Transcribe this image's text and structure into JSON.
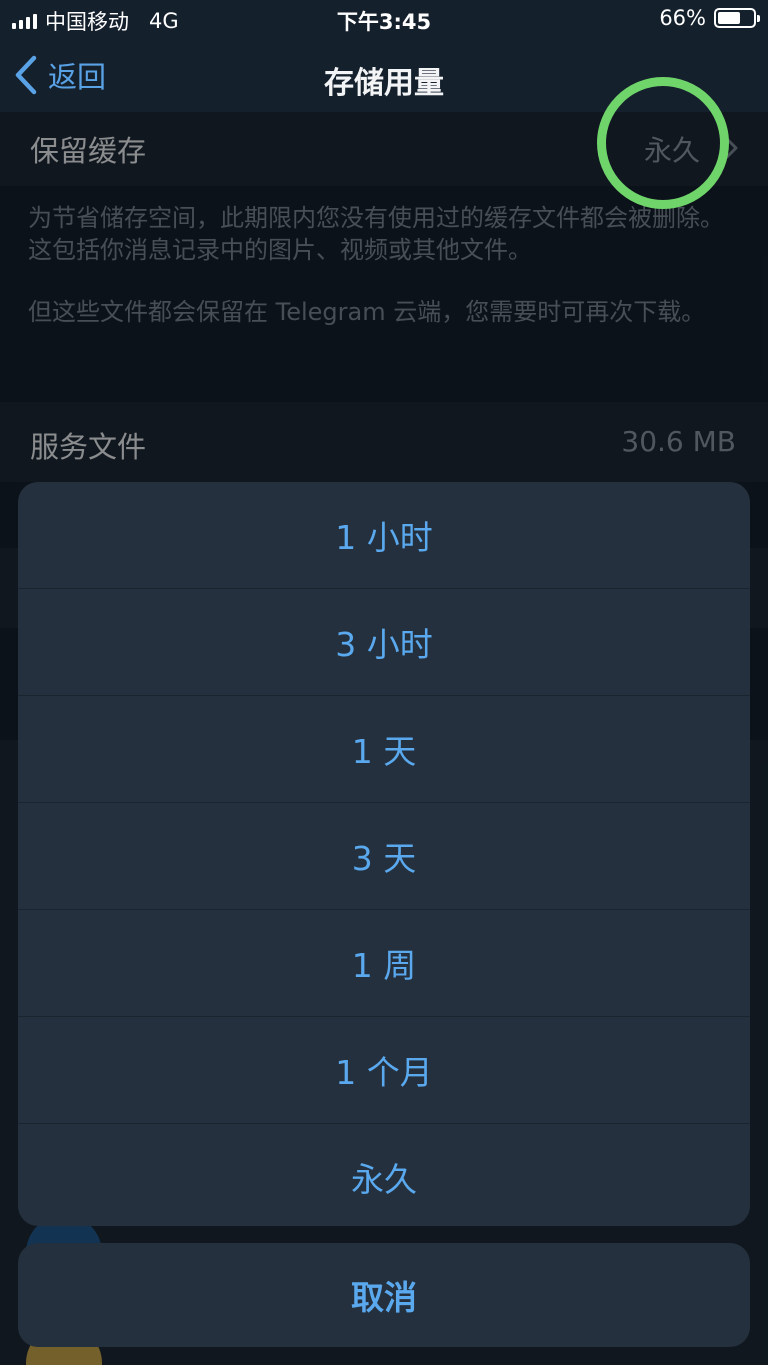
{
  "status_bar": {
    "carrier": "中国移动",
    "network": "4G",
    "time": "下午3:45",
    "battery_percent": "66%",
    "battery_level": 0.66
  },
  "nav": {
    "back_label": "返回",
    "title": "存储用量"
  },
  "keep_media": {
    "label": "保留缓存",
    "value": "永久"
  },
  "description": {
    "para1": "为节省储存空间，此期限内您没有使用过的缓存文件都会被删除。这包括你消息记录中的图片、视频或其他文件。",
    "para2": "但这些文件都会保留在 Telegram 云端，您需要时可再次下载。"
  },
  "service_files": {
    "label": "服务文件",
    "value": "30.6 MB"
  },
  "action_sheet": {
    "options": [
      "1 小时",
      "3 小时",
      "1 天",
      "3 天",
      "1 周",
      "1 个月",
      "永久"
    ],
    "cancel_label": "取消"
  },
  "colors": {
    "accent": "#5aa8ee",
    "highlight": "#6fd46a",
    "background": "#15202d"
  }
}
